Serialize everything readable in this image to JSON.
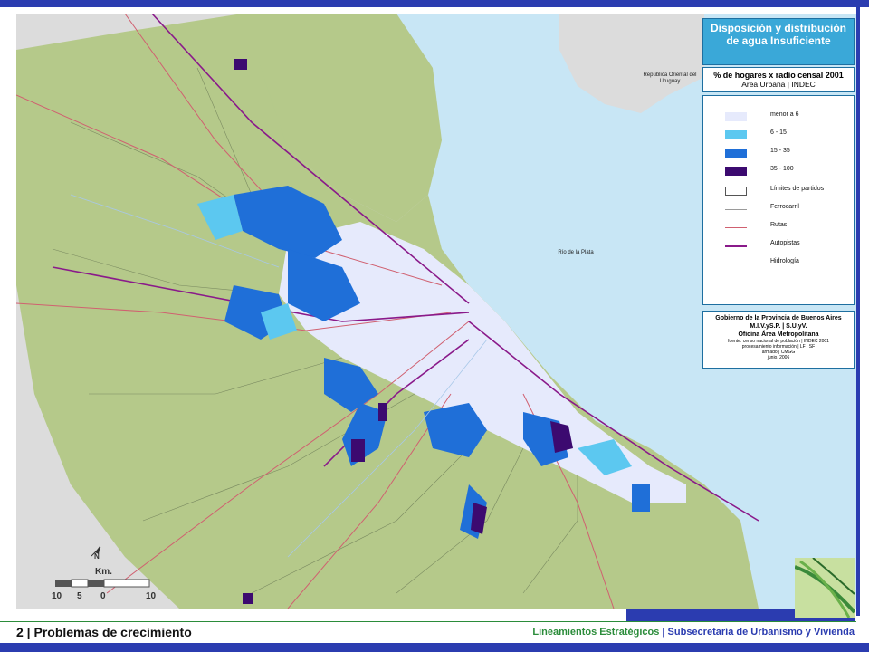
{
  "legend": {
    "title": "Disposición y distribución de agua Insuficiente",
    "subtitle_line1": "% de hogares x radio censal 2001",
    "subtitle_line2": "Area Urbana | INDEC",
    "items": [
      {
        "label": "menor a 6",
        "kind": "fill",
        "color": "#e6eafc"
      },
      {
        "label": "6 - 15",
        "kind": "fill",
        "color": "#5cc8f0"
      },
      {
        "label": "15 - 35",
        "kind": "fill",
        "color": "#1f6fd8"
      },
      {
        "label": "35 - 100",
        "kind": "fill",
        "color": "#3c0a70"
      },
      {
        "label": "Límites de partidos",
        "kind": "outline",
        "color": "#555555"
      },
      {
        "label": "Ferrocarril",
        "kind": "line",
        "color": "#9a9a9a"
      },
      {
        "label": "Rutas",
        "kind": "line",
        "color": "#d06070"
      },
      {
        "label": "Autopistas",
        "kind": "line",
        "color": "#8a1a8a"
      },
      {
        "label": "Hidrología",
        "kind": "line",
        "color": "#a8c8e8"
      }
    ]
  },
  "credits": {
    "line1": "Gobierno de la Provincia de Buenos Aires",
    "line2": "M.I.V.yS.P. | S.U.yV.",
    "line3": "Oficina Área Metropolitana",
    "line4": "fuente. censo nacional de población | INDEC 2001",
    "line5": "procesamiento información | LF | SF",
    "line6": "armado | CMGG",
    "line7": "junio. 2006"
  },
  "map_labels": {
    "uruguay": "República Oriental del Uruguay",
    "rio": "Río de la Plata"
  },
  "scale": {
    "north": "N",
    "unit": "Km.",
    "ticks": [
      "10",
      "5",
      "0",
      "10"
    ]
  },
  "footer": {
    "title": "2 | Problemas de crecimiento",
    "right_green": "Lineamientos Estratégicos",
    "separator": " | ",
    "right_blue": "Subsecretaría de Urbanismo y Vivienda"
  },
  "colors": {
    "brand_blue": "#2b3cb0",
    "brand_green": "#2b8c3a",
    "land": "#b5c98a",
    "water": "#c8e6f5",
    "outside": "#dcdcdc"
  }
}
